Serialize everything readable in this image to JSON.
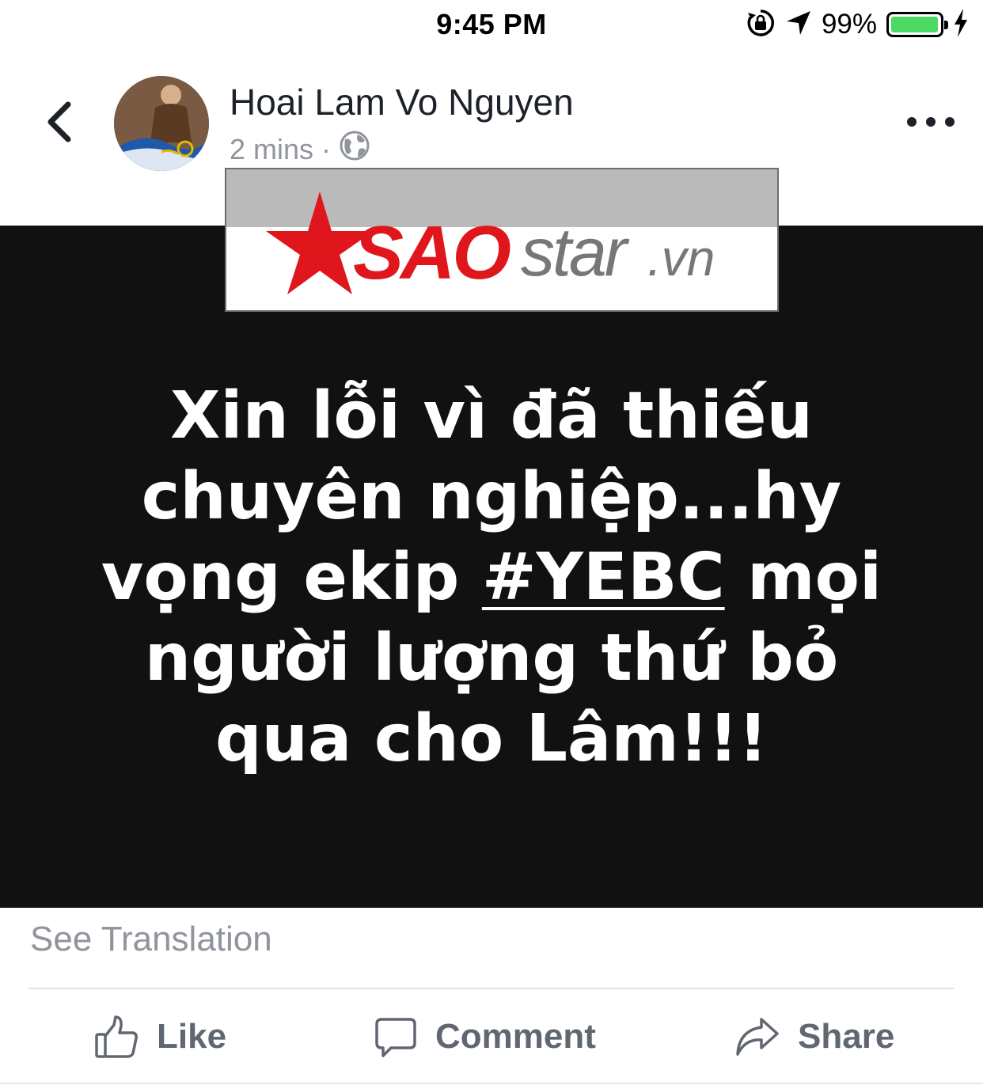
{
  "status_bar": {
    "time": "9:45 PM",
    "battery_percent": "99%",
    "battery_level": 0.99,
    "icons": [
      "orientation-lock-icon",
      "location-arrow-icon",
      "battery-icon",
      "charging-bolt-icon"
    ]
  },
  "header": {
    "back_icon": "chevron-left-icon",
    "author_name": "Hoai Lam Vo Nguyen",
    "time_ago": "2 mins",
    "separator": "·",
    "privacy_icon": "globe-icon",
    "more_icon": "more-dots-icon"
  },
  "post": {
    "watermark_brand": "SAOstar.vn",
    "watermark_sao": "SAO",
    "watermark_star": "star",
    "watermark_domain": ".vn",
    "text_line_1": "Xin lỗi vì đã thiếu",
    "text_line_2": "chuyên nghiệp...hy",
    "text_line_3_pre": "vọng ekip ",
    "hashtag": "#YEBC",
    "text_line_3_post": " mọi",
    "text_line_4": "người lượng thứ bỏ",
    "text_line_5": "qua cho Lâm!!!",
    "background_color": "#111111",
    "text_color": "#ffffff",
    "brand_red": "#e0161d"
  },
  "see_translation": "See Translation",
  "actions": {
    "like_label": "Like",
    "comment_label": "Comment",
    "share_label": "Share"
  },
  "colors": {
    "secondary_text": "#90949c",
    "action_text": "#606770",
    "battery_green": "#4cd964"
  }
}
